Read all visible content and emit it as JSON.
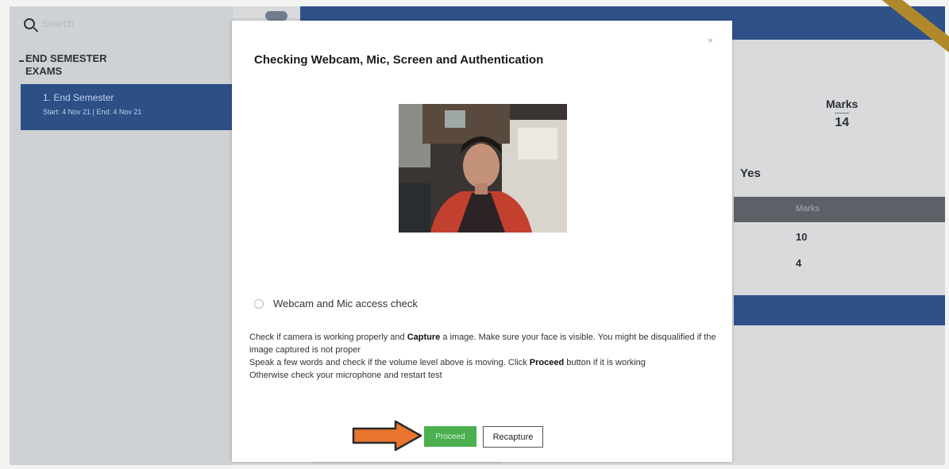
{
  "sidebar": {
    "search_placeholder": "Search",
    "section_title": "END SEMESTER EXAMS",
    "exam_item": {
      "name": "1. End Semester",
      "dates": "Start: 4 Nov 21 | End: 4 Nov 21"
    }
  },
  "background": {
    "marks_label": "Marks",
    "marks_value": "14",
    "yes_text": "Yes",
    "table_header": "Marks",
    "row_values": [
      "10",
      "4"
    ]
  },
  "modal": {
    "title": "Checking Webcam, Mic, Screen and Authentication",
    "close_label": "×",
    "check_label": "Webcam and Mic access check",
    "instr_1a": "Check if camera is working properly and ",
    "instr_1b": "Capture",
    "instr_1c": " a image. Make sure your face is visible. You might be disqualified if the image captured is not proper",
    "instr_2a": "Speak a few words and check if the volume level above is moving. Click ",
    "instr_2b": "Proceed",
    "instr_2c": " button if it is working",
    "instr_3": "Otherwise check your microphone and restart test",
    "proceed_label": "Proceed",
    "recapture_label": "Recapture"
  },
  "colors": {
    "accent_blue": "#2f5189",
    "proceed_green": "#4caf50",
    "arrow_orange": "#e8742e"
  }
}
